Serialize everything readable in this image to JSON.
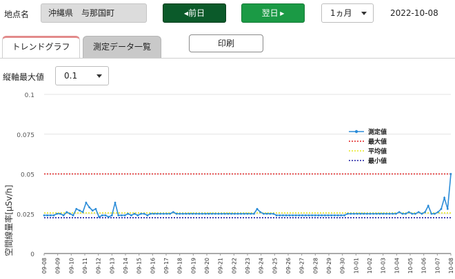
{
  "header": {
    "location_label": "地点名",
    "location_value": "沖縄県　与那国町",
    "prev_label": "前日",
    "next_label": "翌日",
    "period_value": "1ヵ月",
    "date": "2022-10-08"
  },
  "tabs": {
    "trend": "トレンドグラフ",
    "list": "測定データ一覧"
  },
  "print_label": "印刷",
  "axis_control": {
    "label": "縦軸最大値",
    "value": "0.1"
  },
  "colors": {
    "measured": "#2b8cd8",
    "max": "#e02020",
    "avg": "#e6e620",
    "min": "#1a1aa0"
  },
  "chart_data": {
    "type": "line",
    "ylabel": "空間線量率[μSv/h]",
    "ylim": [
      0,
      0.1
    ],
    "yticks": [
      0,
      0.025,
      0.05,
      0.075,
      0.1
    ],
    "ytick_labels": [
      "0",
      "0.025",
      "0.05",
      "0.075",
      "0.1"
    ],
    "categories": [
      "09-08",
      "09-09",
      "09-10",
      "09-11",
      "09-12",
      "09-13",
      "09-14",
      "09-15",
      "09-16",
      "09-17",
      "09-18",
      "09-19",
      "09-20",
      "09-21",
      "09-22",
      "09-23",
      "09-24",
      "09-25",
      "09-26",
      "09-27",
      "09-28",
      "09-29",
      "09-30",
      "10-01",
      "10-02",
      "10-03",
      "10-04",
      "10-05",
      "10-06",
      "10-07",
      "10-08"
    ],
    "legend": [
      "測定値",
      "最大値",
      "平均値",
      "最小値"
    ],
    "legend_position": "right",
    "series": [
      {
        "name": "測定値",
        "values": [
          0.024,
          0.024,
          0.024,
          0.024,
          0.025,
          0.025,
          0.024,
          0.026,
          0.025,
          0.024,
          0.028,
          0.027,
          0.026,
          0.032,
          0.029,
          0.027,
          0.028,
          0.023,
          0.024,
          0.024,
          0.023,
          0.024,
          0.032,
          0.024,
          0.024,
          0.024,
          0.025,
          0.024,
          0.025,
          0.024,
          0.025,
          0.025,
          0.024,
          0.025,
          0.025,
          0.025,
          0.025,
          0.025,
          0.025,
          0.025,
          0.026,
          0.025,
          0.025,
          0.025,
          0.025,
          0.025,
          0.025,
          0.025,
          0.025,
          0.025,
          0.025,
          0.025,
          0.025,
          0.025,
          0.025,
          0.025,
          0.025,
          0.025,
          0.025,
          0.025,
          0.025,
          0.025,
          0.025,
          0.025,
          0.025,
          0.025,
          0.028,
          0.026,
          0.025,
          0.025,
          0.025,
          0.025,
          0.024,
          0.024,
          0.024,
          0.024,
          0.024,
          0.024,
          0.024,
          0.024,
          0.024,
          0.024,
          0.024,
          0.024,
          0.024,
          0.024,
          0.024,
          0.024,
          0.024,
          0.024,
          0.024,
          0.024,
          0.024,
          0.024,
          0.025,
          0.025,
          0.025,
          0.025,
          0.025,
          0.025,
          0.025,
          0.025,
          0.025,
          0.025,
          0.025,
          0.025,
          0.025,
          0.025,
          0.025,
          0.025,
          0.026,
          0.025,
          0.025,
          0.026,
          0.025,
          0.025,
          0.026,
          0.025,
          0.026,
          0.03,
          0.025,
          0.025,
          0.026,
          0.028,
          0.035,
          0.028,
          0.05
        ]
      },
      {
        "name": "最大値",
        "value": 0.05
      },
      {
        "name": "平均値",
        "value": 0.0255
      },
      {
        "name": "最小値",
        "value": 0.0225
      }
    ]
  }
}
